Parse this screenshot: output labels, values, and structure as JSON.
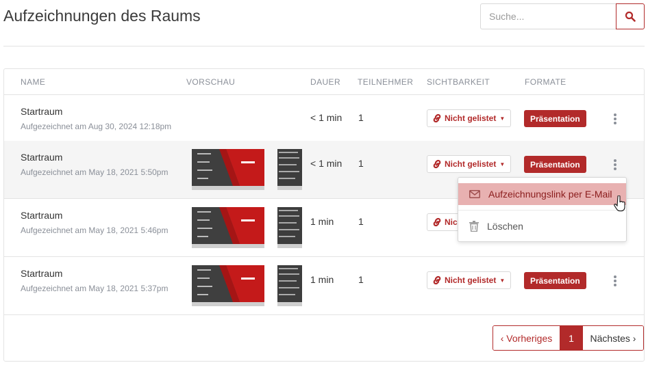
{
  "page": {
    "title": "Aufzeichnungen des Raums"
  },
  "search": {
    "placeholder": "Suche...",
    "icon": "search-icon"
  },
  "table": {
    "headers": [
      "NAME",
      "VORSCHAU",
      "DAUER",
      "TEILNEHMER",
      "SICHTBARKEIT",
      "FORMATE"
    ],
    "rows": [
      {
        "name": "Startraum",
        "recorded": "Aufgezeichnet am Aug 30, 2024 12:18pm",
        "has_preview": false,
        "duration": "< 1 min",
        "participants": "1",
        "visibility": "Nicht gelistet",
        "format": "Präsentation"
      },
      {
        "name": "Startraum",
        "recorded": "Aufgezeichnet am May 18, 2021 5:50pm",
        "has_preview": true,
        "duration": "< 1 min",
        "participants": "1",
        "visibility": "Nicht gelistet",
        "format": "Präsentation"
      },
      {
        "name": "Startraum",
        "recorded": "Aufgezeichnet am May 18, 2021 5:46pm",
        "has_preview": true,
        "duration": "1 min",
        "participants": "1",
        "visibility": "Nic",
        "format": ""
      },
      {
        "name": "Startraum",
        "recorded": "Aufgezeichnet am May 18, 2021 5:37pm",
        "has_preview": true,
        "duration": "1 min",
        "participants": "1",
        "visibility": "Nicht gelistet",
        "format": "Präsentation"
      }
    ]
  },
  "dropdown": {
    "items": [
      {
        "label": "Aufzeichnungslink per E-Mail",
        "icon": "envelope-icon",
        "highlighted": true
      },
      {
        "label": "Löschen",
        "icon": "trash-icon",
        "highlighted": false
      }
    ]
  },
  "pagination": {
    "prev": "‹ Vorheriges",
    "current": "1",
    "next": "Nächstes ›"
  },
  "colors": {
    "accent": "#b22a2a",
    "highlight": "#e8b1b1",
    "muted": "#8a8f98"
  }
}
